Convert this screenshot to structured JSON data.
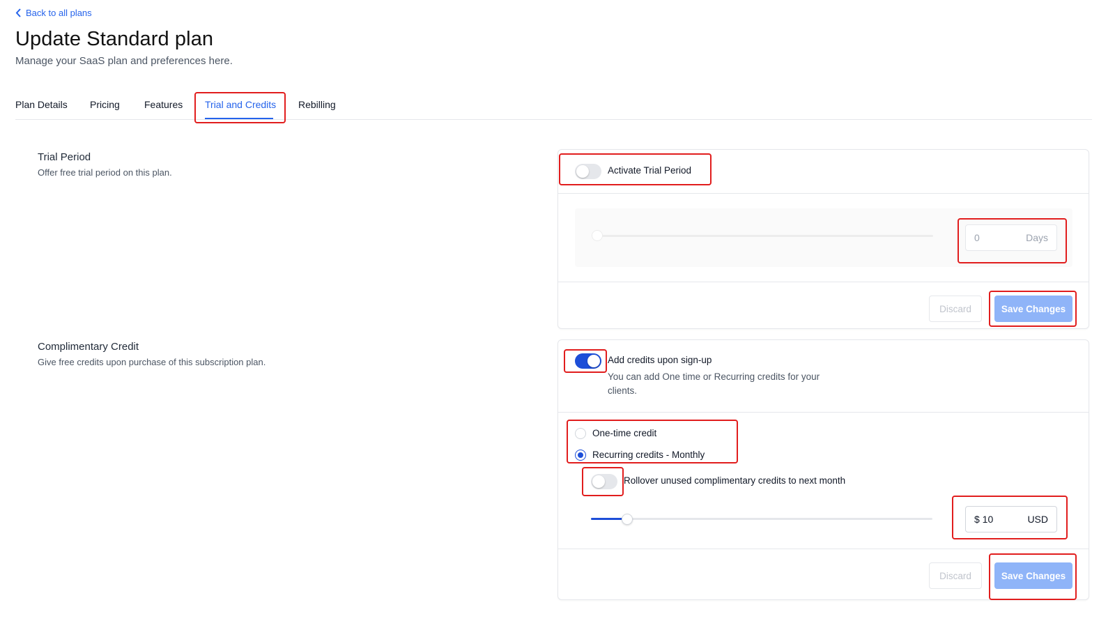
{
  "nav": {
    "back_label": "Back to all plans"
  },
  "header": {
    "title": "Update Standard plan",
    "subtitle": "Manage your SaaS plan and preferences here."
  },
  "tabs": [
    {
      "label": "Plan Details",
      "active": false
    },
    {
      "label": "Pricing",
      "active": false
    },
    {
      "label": "Features",
      "active": false
    },
    {
      "label": "Trial and Credits",
      "active": true
    },
    {
      "label": "Rebilling",
      "active": false
    }
  ],
  "trial": {
    "title": "Trial Period",
    "description": "Offer free trial period on this plan.",
    "toggle_label": "Activate Trial Period",
    "toggle_on": false,
    "slider_value": 0,
    "days_value": "0",
    "days_unit": "Days",
    "discard_label": "Discard",
    "save_label": "Save Changes"
  },
  "credit": {
    "title": "Complimentary Credit",
    "description": "Give free credits upon purchase of this subscription plan.",
    "toggle_label": "Add credits upon sign-up",
    "toggle_on": true,
    "help": "You can add One time or Recurring credits for your clients.",
    "options": [
      {
        "label": "One-time credit",
        "selected": false
      },
      {
        "label": "Recurring credits - Monthly",
        "selected": true
      }
    ],
    "rollover_label": "Rollover unused complimentary credits to next month",
    "rollover_on": false,
    "amount_value": "$ 10",
    "amount_unit": "USD",
    "discard_label": "Discard",
    "save_label": "Save Changes"
  },
  "colors": {
    "accent": "#2563eb",
    "toggle_on": "#1d4ed8",
    "save_button": "#8fb4f8",
    "highlight": "#e11d1d"
  }
}
